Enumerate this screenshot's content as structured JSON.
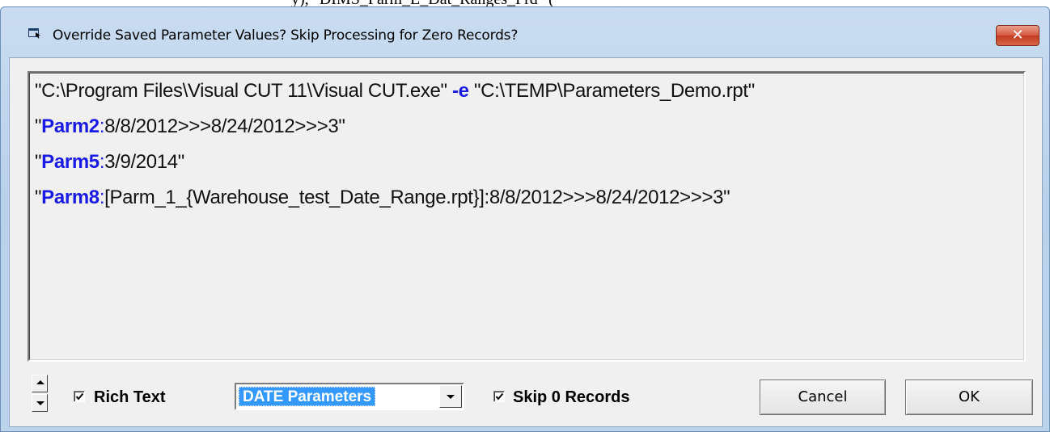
{
  "clipped_header_fragment": "y), \"DIMS_Parm_L_Dat_Ranges_Prd\" ( ",
  "window": {
    "title": "Override Saved Parameter Values?  Skip Processing for Zero Records?",
    "close_label": "✕"
  },
  "editor": {
    "lines": [
      {
        "parts": [
          {
            "text": "\"C:\\Program Files\\Visual CUT 11\\Visual CUT.exe\" ",
            "style": "plain"
          },
          {
            "text": "-e",
            "style": "keyword"
          },
          {
            "text": " \"C:\\TEMP\\Parameters_Demo.rpt\"",
            "style": "plain"
          }
        ]
      },
      {
        "parts": [
          {
            "text": "\"",
            "style": "plain"
          },
          {
            "text": "Parm2",
            "style": "keyword"
          },
          {
            "text": ":",
            "style": "punct"
          },
          {
            "text": "8/8/2012>>>8/24/2012>>>3\"",
            "style": "plain"
          }
        ]
      },
      {
        "parts": [
          {
            "text": "\"",
            "style": "plain"
          },
          {
            "text": "Parm5",
            "style": "keyword"
          },
          {
            "text": ":",
            "style": "punct"
          },
          {
            "text": "3/9/2014\"",
            "style": "plain"
          }
        ]
      },
      {
        "parts": [
          {
            "text": "\"",
            "style": "plain"
          },
          {
            "text": "Parm8",
            "style": "keyword"
          },
          {
            "text": ":",
            "style": "punct"
          },
          {
            "text": "[Parm_1_{Warehouse_test_Date_Range.rpt}]:8/8/2012>>>8/24/2012>>>3\"",
            "style": "plain"
          }
        ]
      }
    ],
    "colors": {
      "keyword": "#1a1ae6",
      "text": "#111111"
    }
  },
  "controls": {
    "rich_text": {
      "label": "Rich Text",
      "checked": true
    },
    "parameter_filter": {
      "selected": "DATE Parameters"
    },
    "skip_zero": {
      "label": "Skip 0 Records",
      "checked": true
    },
    "cancel_label": "Cancel",
    "ok_label": "OK"
  }
}
